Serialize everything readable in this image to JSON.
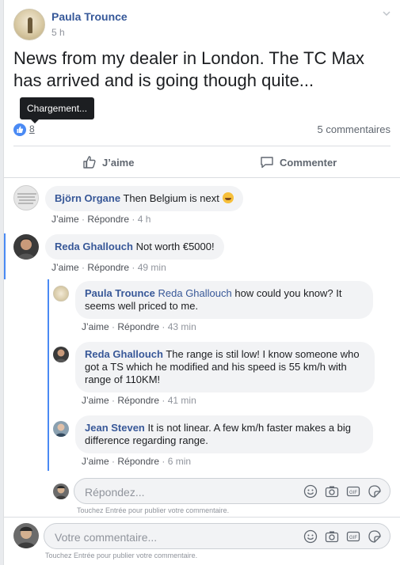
{
  "post": {
    "author": "Paula Trounce",
    "time": "5 h",
    "text": "News from my dealer in London. The TC Max has arrived and is going though quite...",
    "likes": "8",
    "comments_count": "5 commentaires",
    "tooltip": "Chargement..."
  },
  "actions": {
    "like": "J’aime",
    "comment": "Commenter"
  },
  "comments": [
    {
      "name": "Björn Organe",
      "text": "Then Belgium is next",
      "like": "J’aime",
      "reply": "Répondre",
      "time": "4 h"
    },
    {
      "name": "Reda Ghallouch",
      "text": "Not worth €5000!",
      "like": "J’aime",
      "reply": "Répondre",
      "time": "49 min"
    }
  ],
  "replies": [
    {
      "name": "Paula Trounce",
      "tag": "Reda Ghallouch",
      "text": "how could you know? It seems well priced to me.",
      "like": "J’aime",
      "reply": "Répondre",
      "time": "43 min"
    },
    {
      "name": "Reda Ghallouch",
      "text": "The range is stil low! I know someone who got a TS which he modified and his speed is 55 km/h with range of 110KM!",
      "like": "J’aime",
      "reply": "Répondre",
      "time": "41 min"
    },
    {
      "name": "Jean Steven",
      "text": "It is not linear. A few km/h faster makes a big difference regarding range.",
      "like": "J’aime",
      "reply": "Répondre",
      "time": "6 min"
    }
  ],
  "reply_input": {
    "placeholder": "Répondez...",
    "hint": "Touchez Entrée pour publier votre commentaire."
  },
  "comment_input": {
    "placeholder": "Votre commentaire...",
    "hint": "Touchez Entrée pour publier votre commentaire."
  },
  "colors": {
    "link": "#385898",
    "accent": "#4a8af4",
    "muted": "#90949c"
  }
}
